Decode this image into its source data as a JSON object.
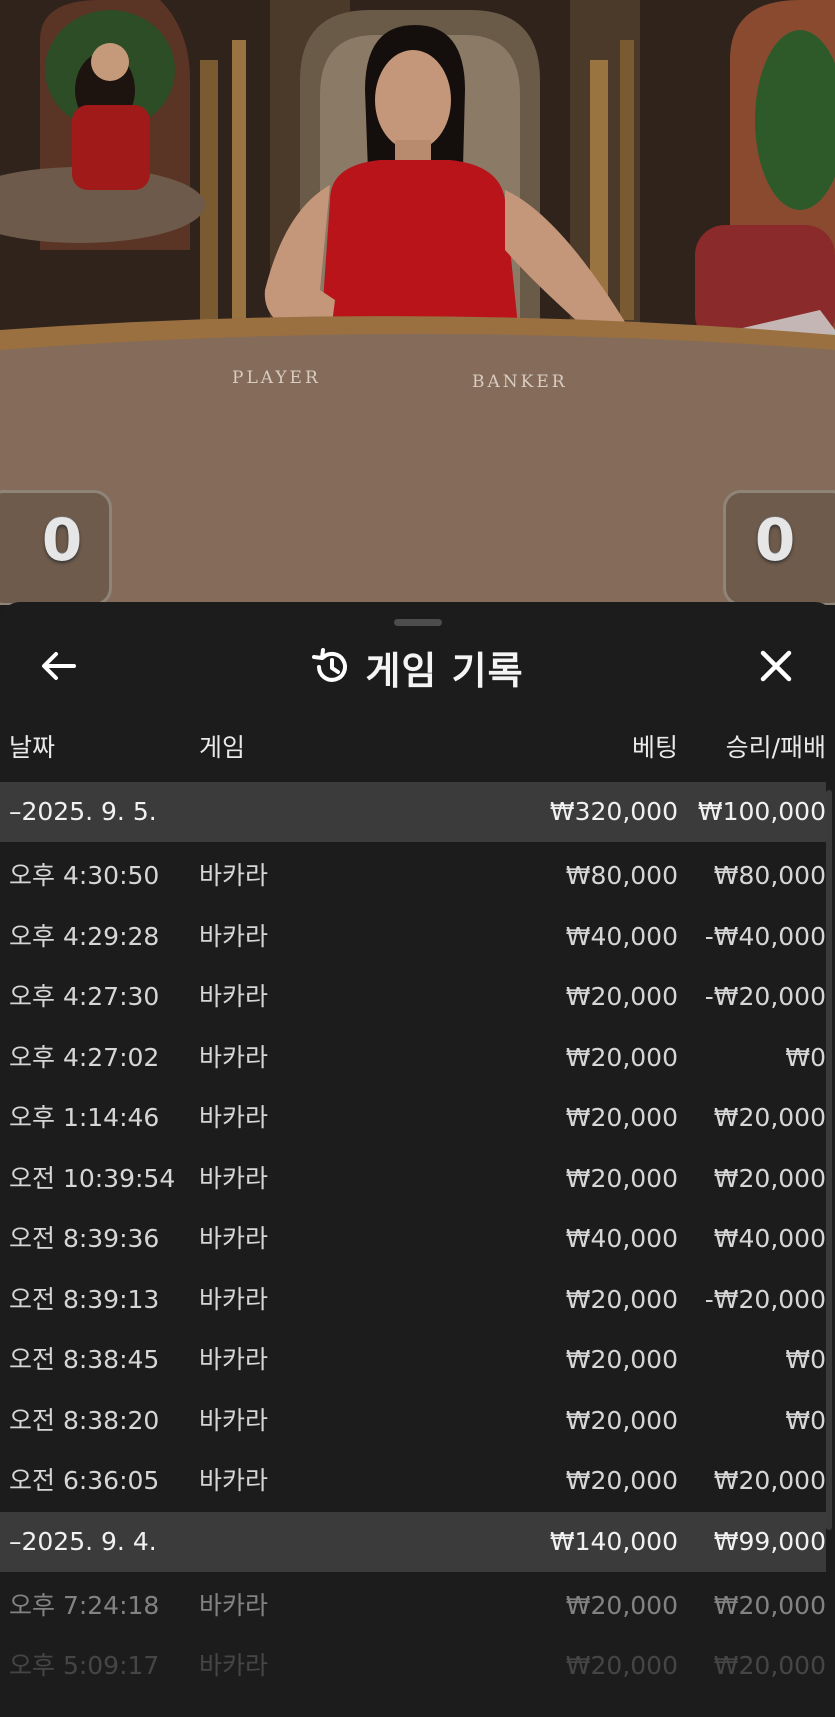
{
  "video": {
    "table_labels": {
      "player": "PLAYER",
      "banker": "BANKER"
    },
    "scores": {
      "player": "0",
      "banker": "0"
    }
  },
  "history": {
    "title": "게임 기록",
    "icons": {
      "back": "arrow-left-icon",
      "history": "history-clock-icon",
      "close": "close-x-icon"
    },
    "columns": {
      "date": "날짜",
      "game": "게임",
      "bet": "베팅",
      "result": "승리/패배"
    },
    "groups": [
      {
        "date": "–2025. 9. 5.",
        "bet_total": "₩320,000",
        "result_total": "₩100,000",
        "rows": [
          {
            "time": "오후 4:30:50",
            "game": "바카라",
            "bet": "₩80,000",
            "result": "₩80,000"
          },
          {
            "time": "오후 4:29:28",
            "game": "바카라",
            "bet": "₩40,000",
            "result": "-₩40,000"
          },
          {
            "time": "오후 4:27:30",
            "game": "바카라",
            "bet": "₩20,000",
            "result": "-₩20,000"
          },
          {
            "time": "오후 4:27:02",
            "game": "바카라",
            "bet": "₩20,000",
            "result": "₩0"
          },
          {
            "time": "오후 1:14:46",
            "game": "바카라",
            "bet": "₩20,000",
            "result": "₩20,000"
          },
          {
            "time": "오전 10:39:54",
            "game": "바카라",
            "bet": "₩20,000",
            "result": "₩20,000"
          },
          {
            "time": "오전 8:39:36",
            "game": "바카라",
            "bet": "₩40,000",
            "result": "₩40,000"
          },
          {
            "time": "오전 8:39:13",
            "game": "바카라",
            "bet": "₩20,000",
            "result": "-₩20,000"
          },
          {
            "time": "오전 8:38:45",
            "game": "바카라",
            "bet": "₩20,000",
            "result": "₩0"
          },
          {
            "time": "오전 8:38:20",
            "game": "바카라",
            "bet": "₩20,000",
            "result": "₩0"
          },
          {
            "time": "오전 6:36:05",
            "game": "바카라",
            "bet": "₩20,000",
            "result": "₩20,000"
          }
        ]
      },
      {
        "date": "–2025. 9. 4.",
        "bet_total": "₩140,000",
        "result_total": "₩99,000",
        "rows": [
          {
            "time": "오후 7:24:18",
            "game": "바카라",
            "bet": "₩20,000",
            "result": "₩20,000"
          },
          {
            "time": "오후 5:09:17",
            "game": "바카라",
            "bet": "₩20,000",
            "result": "₩20,000"
          }
        ]
      }
    ]
  }
}
